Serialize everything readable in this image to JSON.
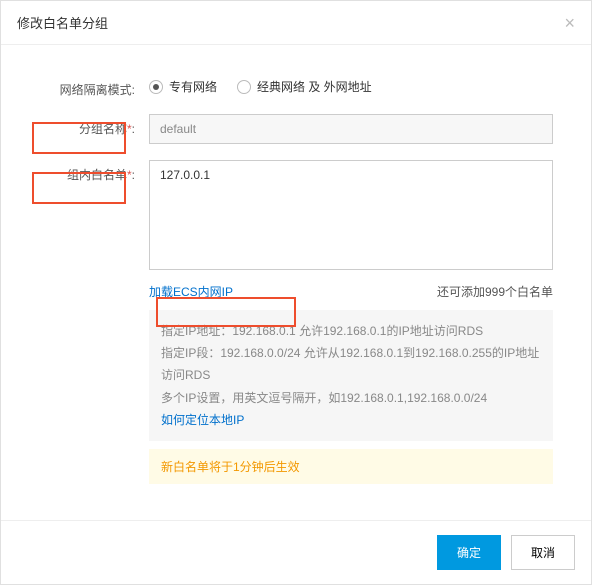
{
  "modal": {
    "title": "修改白名单分组",
    "close_label": "×"
  },
  "form": {
    "network_mode_label": "网络隔离模式:",
    "network_options": {
      "vpc": "专有网络",
      "classic": "经典网络 及 外网地址"
    },
    "group_name_label": "分组名称",
    "group_name_value": "default",
    "whitelist_label": "组内白名单",
    "whitelist_value": "127.0.0.1",
    "load_ecs_link": "加载ECS内网IP",
    "remaining_hint": "还可添加999个白名单"
  },
  "help": {
    "line1": "指定IP地址：192.168.0.1 允许192.168.0.1的IP地址访问RDS",
    "line2": "指定IP段：192.168.0.0/24 允许从192.168.0.1到192.168.0.255的IP地址访问RDS",
    "line3": "多个IP设置，用英文逗号隔开，如192.168.0.1,192.168.0.0/24",
    "local_ip_link": "如何定位本地IP"
  },
  "notice": "新白名单将于1分钟后生效",
  "footer": {
    "ok": "确定",
    "cancel": "取消"
  },
  "asterisk": "*",
  "colon": ":"
}
